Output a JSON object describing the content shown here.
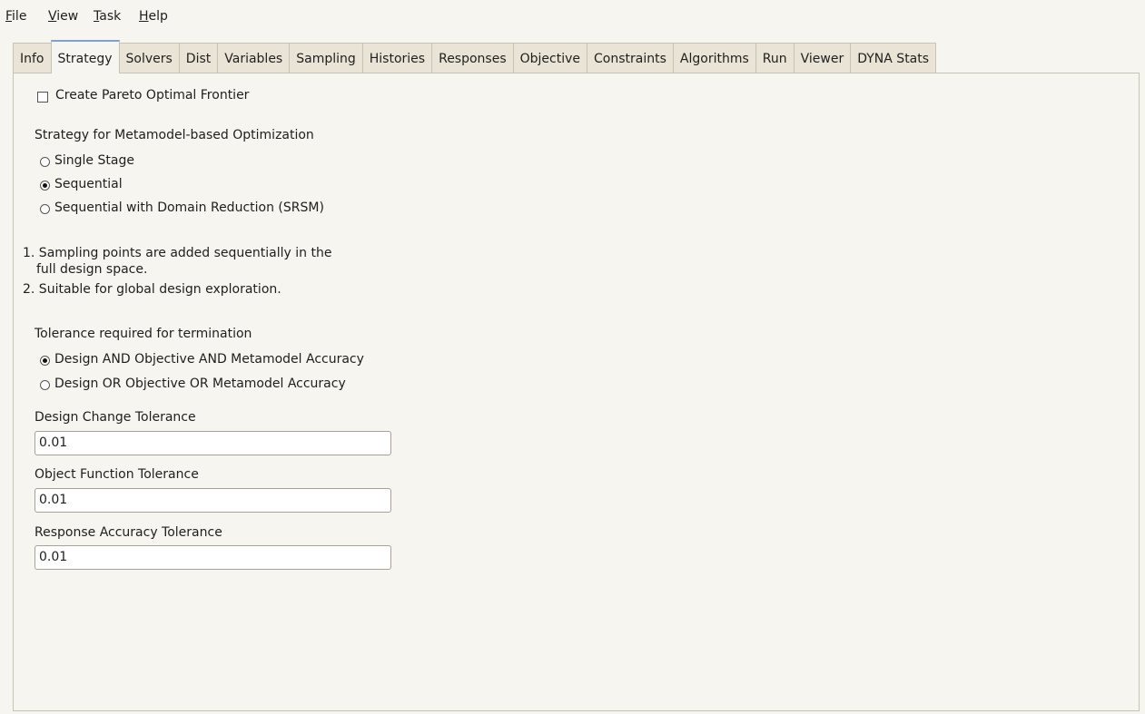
{
  "menu": {
    "file": {
      "mnemonic": "F",
      "rest": "ile"
    },
    "view": {
      "mnemonic": "V",
      "rest": "iew"
    },
    "task": {
      "mnemonic": "T",
      "rest": "ask"
    },
    "help": {
      "mnemonic": "H",
      "rest": "elp"
    }
  },
  "tabs": [
    "Info",
    "Strategy",
    "Solvers",
    "Dist",
    "Variables",
    "Sampling",
    "Histories",
    "Responses",
    "Objective",
    "Constraints",
    "Algorithms",
    "Run",
    "Viewer",
    "DYNA Stats"
  ],
  "active_tab": "Strategy",
  "pareto": {
    "label": "Create Pareto Optimal Frontier",
    "checked": false
  },
  "strategy": {
    "heading": "Strategy for Metamodel-based Optimization",
    "options": [
      {
        "label": "Single Stage",
        "selected": false
      },
      {
        "label": "Sequential",
        "selected": true
      },
      {
        "label": "Sequential with Domain Reduction (SRSM)",
        "selected": false
      }
    ]
  },
  "description": {
    "line1": "1. Sampling points are added sequentially in the",
    "line2": "full design space.",
    "line3": "2. Suitable for global design exploration."
  },
  "tolerance": {
    "heading": "Tolerance required for termination",
    "options": [
      {
        "label": "Design AND Objective AND Metamodel Accuracy",
        "selected": true
      },
      {
        "label": "Design OR Objective OR Metamodel Accuracy",
        "selected": false
      }
    ]
  },
  "fields": {
    "design_change": {
      "label": "Design Change Tolerance",
      "value": "0.01"
    },
    "object_function": {
      "label": "Object Function Tolerance",
      "value": "0.01"
    },
    "response_accuracy": {
      "label": "Response Accuracy Tolerance",
      "value": "0.01"
    }
  }
}
